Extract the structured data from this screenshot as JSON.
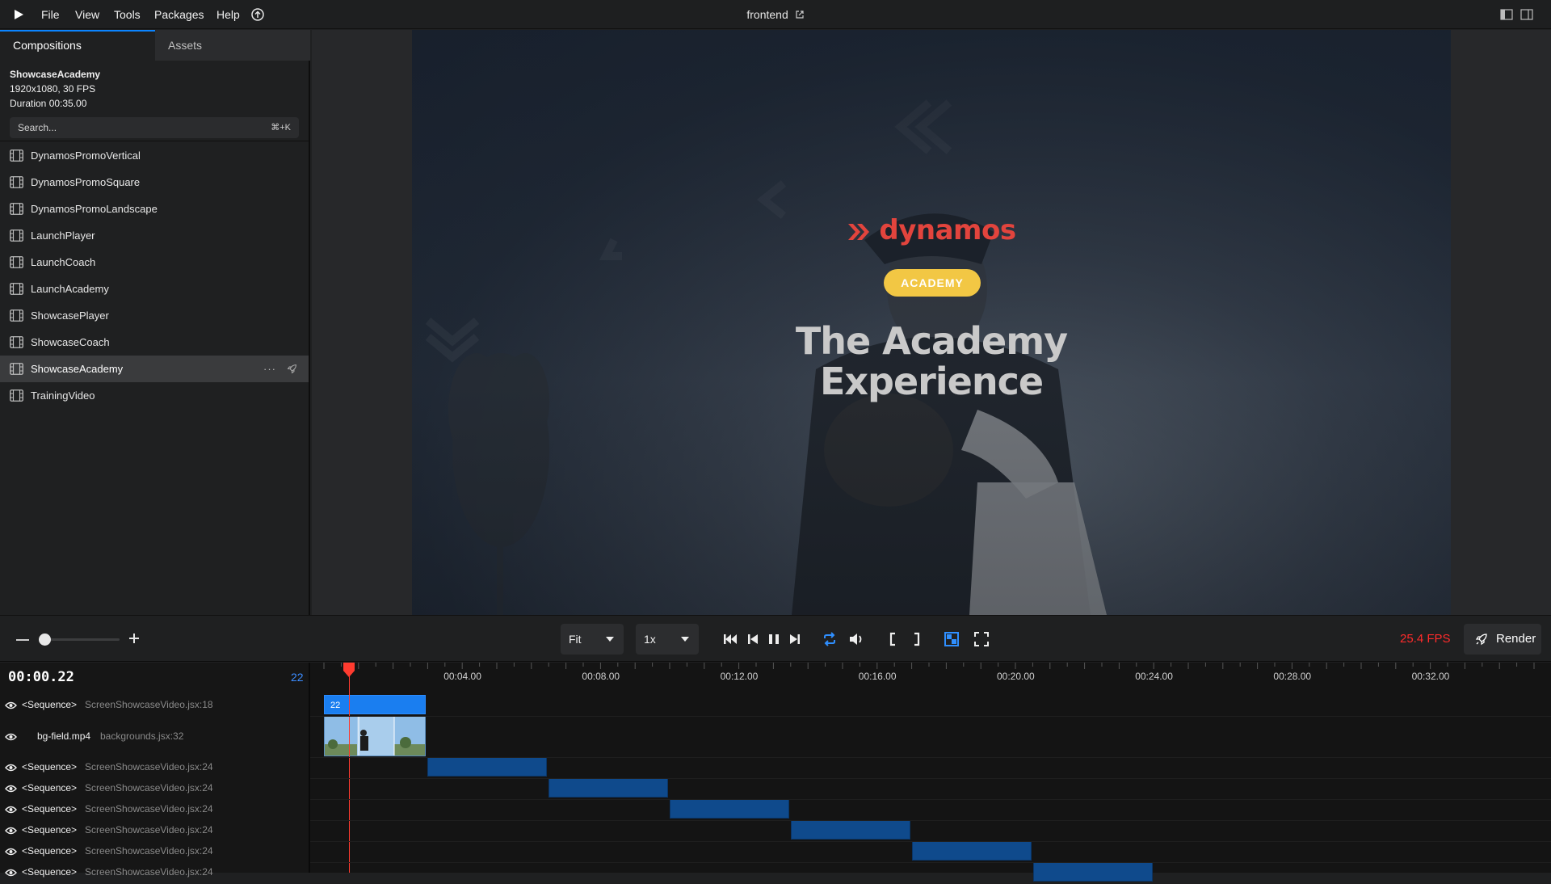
{
  "menubar": {
    "items": [
      "File",
      "View",
      "Tools",
      "Packages",
      "Help"
    ],
    "title": "frontend"
  },
  "left_panel": {
    "tabs": [
      "Compositions",
      "Assets"
    ],
    "composition": {
      "name": "ShowcaseAcademy",
      "resolution": "1920x1080, 30 FPS",
      "duration": "Duration 00:35.00"
    },
    "search": {
      "placeholder": "Search...",
      "shortcut": "⌘+K"
    },
    "items": [
      "DynamosPromoVertical",
      "DynamosPromoSquare",
      "DynamosPromoLandscape",
      "LaunchPlayer",
      "LaunchCoach",
      "LaunchAcademy",
      "ShowcasePlayer",
      "ShowcaseCoach",
      "ShowcaseAcademy",
      "TrainingVideo"
    ],
    "selected_index": 8,
    "more_label": "···"
  },
  "preview": {
    "brand": "dynamos",
    "badge": "ACADEMY",
    "headline_line1": "The Academy",
    "headline_line2": "Experience",
    "colors": {
      "brand": "#e2443d",
      "badge": "#f2c744"
    }
  },
  "controls": {
    "fit_label": "Fit",
    "speed_label": "1x",
    "fps": "25.4 FPS",
    "render_label": "Render"
  },
  "timeline": {
    "timecode": "00:00.22",
    "frame": "22",
    "tick_labels": [
      "00:04.00",
      "00:08.00",
      "00:12.00",
      "00:16.00",
      "00:20.00",
      "00:24.00",
      "00:28.00",
      "00:32.00"
    ],
    "active_clip_label": "22",
    "tracks": [
      {
        "name": "<Sequence>",
        "src": "ScreenShowcaseVideo.jsx:18"
      },
      {
        "name": "bg-field.mp4",
        "src": "backgrounds.jsx:32"
      },
      {
        "name": "<Sequence>",
        "src": "ScreenShowcaseVideo.jsx:24"
      },
      {
        "name": "<Sequence>",
        "src": "ScreenShowcaseVideo.jsx:24"
      },
      {
        "name": "<Sequence>",
        "src": "ScreenShowcaseVideo.jsx:24"
      },
      {
        "name": "<Sequence>",
        "src": "ScreenShowcaseVideo.jsx:24"
      },
      {
        "name": "<Sequence>",
        "src": "ScreenShowcaseVideo.jsx:24"
      },
      {
        "name": "<Sequence>",
        "src": "ScreenShowcaseVideo.jsx:24"
      }
    ]
  }
}
